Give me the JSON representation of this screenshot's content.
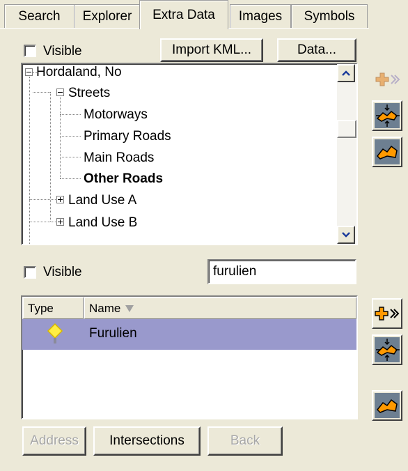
{
  "tabs": [
    {
      "label": "Search"
    },
    {
      "label": "Explorer"
    },
    {
      "label": "Extra Data"
    },
    {
      "label": "Images"
    },
    {
      "label": "Symbols"
    }
  ],
  "active_tab": "Extra Data",
  "top_panel": {
    "visible_label": "Visible",
    "import_button": "Import KML...",
    "data_button": "Data...",
    "tree": {
      "root": "Hordaland, No",
      "streets": "Streets",
      "children": [
        "Motorways",
        "Primary Roads",
        "Main Roads",
        "Other Roads"
      ],
      "land_use_a": "Land Use A",
      "land_use_b": "Land Use B"
    }
  },
  "bottom_panel": {
    "visible_label": "Visible",
    "search_value": "furulien",
    "columns": {
      "type": "Type",
      "name": "Name"
    },
    "rows": [
      {
        "name": "Furulien",
        "selected": true
      }
    ],
    "address_button": "Address",
    "intersections_button": "Intersections",
    "back_button": "Back"
  },
  "colors": {
    "selection": "#9999cc",
    "window_bg": "#ece9d8",
    "accent": "#ff9900"
  }
}
